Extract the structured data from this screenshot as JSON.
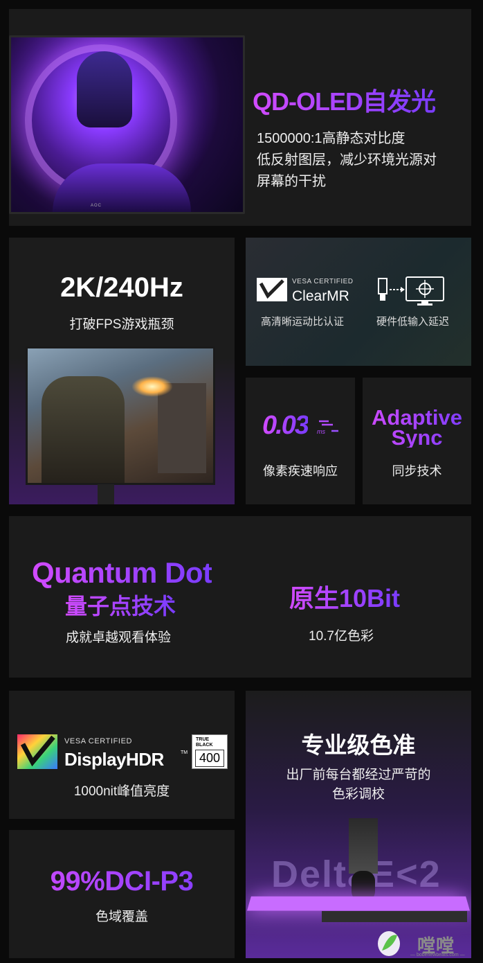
{
  "oled": {
    "title": "QD-OLED自发光",
    "lines": [
      "1500000:1高静态对比度",
      "低反射图层，减少环境光源对",
      "屏幕的干扰"
    ],
    "monitor_brand": "AOC"
  },
  "refresh": {
    "title": "2K/240Hz",
    "sub": "打破FPS游戏瓶颈"
  },
  "clearmr": {
    "vesa_label": "VESA CERTIFIED",
    "name": "ClearMR",
    "left_label": "高清晰运动比认证",
    "right_label": "硬件低输入延迟"
  },
  "response": {
    "value": "0.03",
    "unit": "ms",
    "label": "像素疾速响应"
  },
  "adaptive": {
    "line1": "Adaptive",
    "line2": "Sync",
    "label": "同步技术"
  },
  "quantum": {
    "en": "Quantum Dot",
    "cn": "量子点技术",
    "sub": "成就卓越观看体验"
  },
  "bit10": {
    "title": "原生10Bit",
    "sub": "10.7亿色彩"
  },
  "hdr": {
    "vesa_label": "VESA CERTIFIED",
    "name": "DisplayHDR",
    "tm": "TM",
    "badge_top": "TRUE BLACK",
    "badge_num": "400",
    "sub": "1000nit峰值亮度"
  },
  "gamut": {
    "title": "99%DCI-P3",
    "sub": "色域覆盖"
  },
  "pro": {
    "title": "专业级色准",
    "lines": [
      "出厂前每台都经过严苛的",
      "色彩调校"
    ],
    "delta": "DeltaE<2",
    "watermark": "嘡嘡网",
    "watermark_url": "— bobenewbeats.com —"
  },
  "colors": {
    "accent": "#b34bff",
    "card": "#1b1b1b",
    "bg": "#0a0a0a"
  }
}
